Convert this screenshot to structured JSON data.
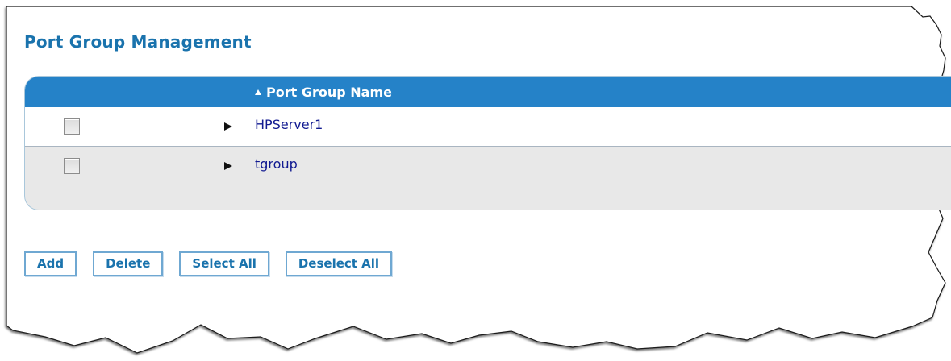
{
  "page": {
    "title": "Port Group Management"
  },
  "table": {
    "header": {
      "column_label": "Port Group Name",
      "sort_icon": "sort-up-icon"
    },
    "rows": [
      {
        "name": "HPServer1",
        "checked": false,
        "expand_icon": "expand-right-icon"
      },
      {
        "name": "tgroup",
        "checked": false,
        "expand_icon": "expand-right-icon"
      }
    ]
  },
  "buttons": {
    "add": "Add",
    "delete": "Delete",
    "select_all": "Select All",
    "deselect_all": "Deselect All"
  },
  "colors": {
    "accent": "#1a73ad",
    "header": "#2582c8",
    "row_link": "#111a91"
  }
}
